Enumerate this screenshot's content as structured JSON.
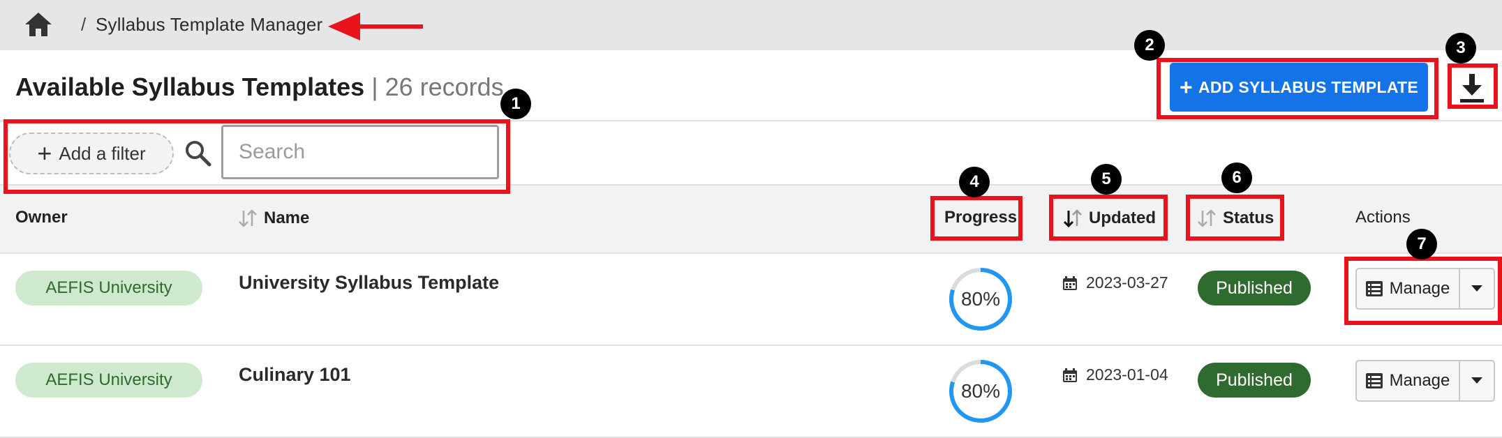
{
  "breadcrumb": {
    "separator": "/",
    "current": "Syllabus Template Manager"
  },
  "header": {
    "title": "Available Syllabus Templates",
    "count_text": "| 26 records",
    "add_button_label": "ADD SYLLABUS TEMPLATE"
  },
  "filters": {
    "add_filter_label": "Add a filter",
    "search_placeholder": "Search"
  },
  "table": {
    "columns": [
      "Owner",
      "Name",
      "Progress",
      "Updated",
      "Status",
      "Actions"
    ],
    "rows": [
      {
        "owner": "AEFIS University",
        "name": "University Syllabus Template",
        "progress": "80%",
        "progress_value": 0.8,
        "updated": "2023-03-27",
        "status": "Published",
        "action_label": "Manage"
      },
      {
        "owner": "AEFIS University",
        "name": "Culinary 101",
        "progress": "80%",
        "progress_value": 0.8,
        "updated": "2023-01-04",
        "status": "Published",
        "action_label": "Manage"
      }
    ]
  },
  "annotations": {
    "markers": [
      "1",
      "2",
      "3",
      "4",
      "5",
      "6",
      "7"
    ],
    "highlight_color": "#e8131b"
  },
  "colors": {
    "primary": "#1473e6",
    "owner_badge_bg": "#cfe9cf",
    "status_published": "#2f6a2f",
    "progress_ring": "#2196f3"
  },
  "icons": [
    "home-icon",
    "arrow-left-icon",
    "plus-icon",
    "search-icon",
    "download-icon",
    "sort-icon",
    "calendar-icon",
    "list-icon",
    "caret-down-icon"
  ]
}
